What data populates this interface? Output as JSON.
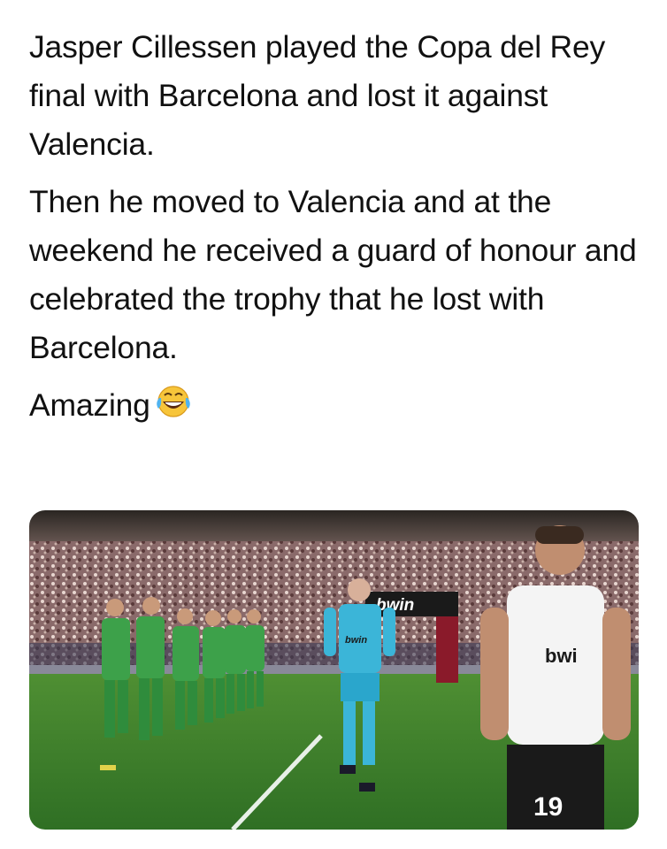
{
  "post": {
    "paragraphs": [
      "Jasper Cillessen played the Copa del Rey final with Barcelona and lost it against Valencia.",
      "Then he moved to Valencia and at the weekend he received a guard of honour and celebrated the trophy that he lost with Barcelona.",
      "Amazing"
    ],
    "emoji": "face-with-tears-of-joy-icon"
  },
  "photo": {
    "banner_text": "bwin",
    "keeper_shirt_text": "bwin",
    "player_shirt_text": "bwi",
    "player_number": "19",
    "colors": {
      "pitch": "#3f8a2e",
      "opponent_kit": "#3da14a",
      "keeper_kit": "#3bb5d8",
      "home_kit": "#f4f4f4"
    }
  }
}
